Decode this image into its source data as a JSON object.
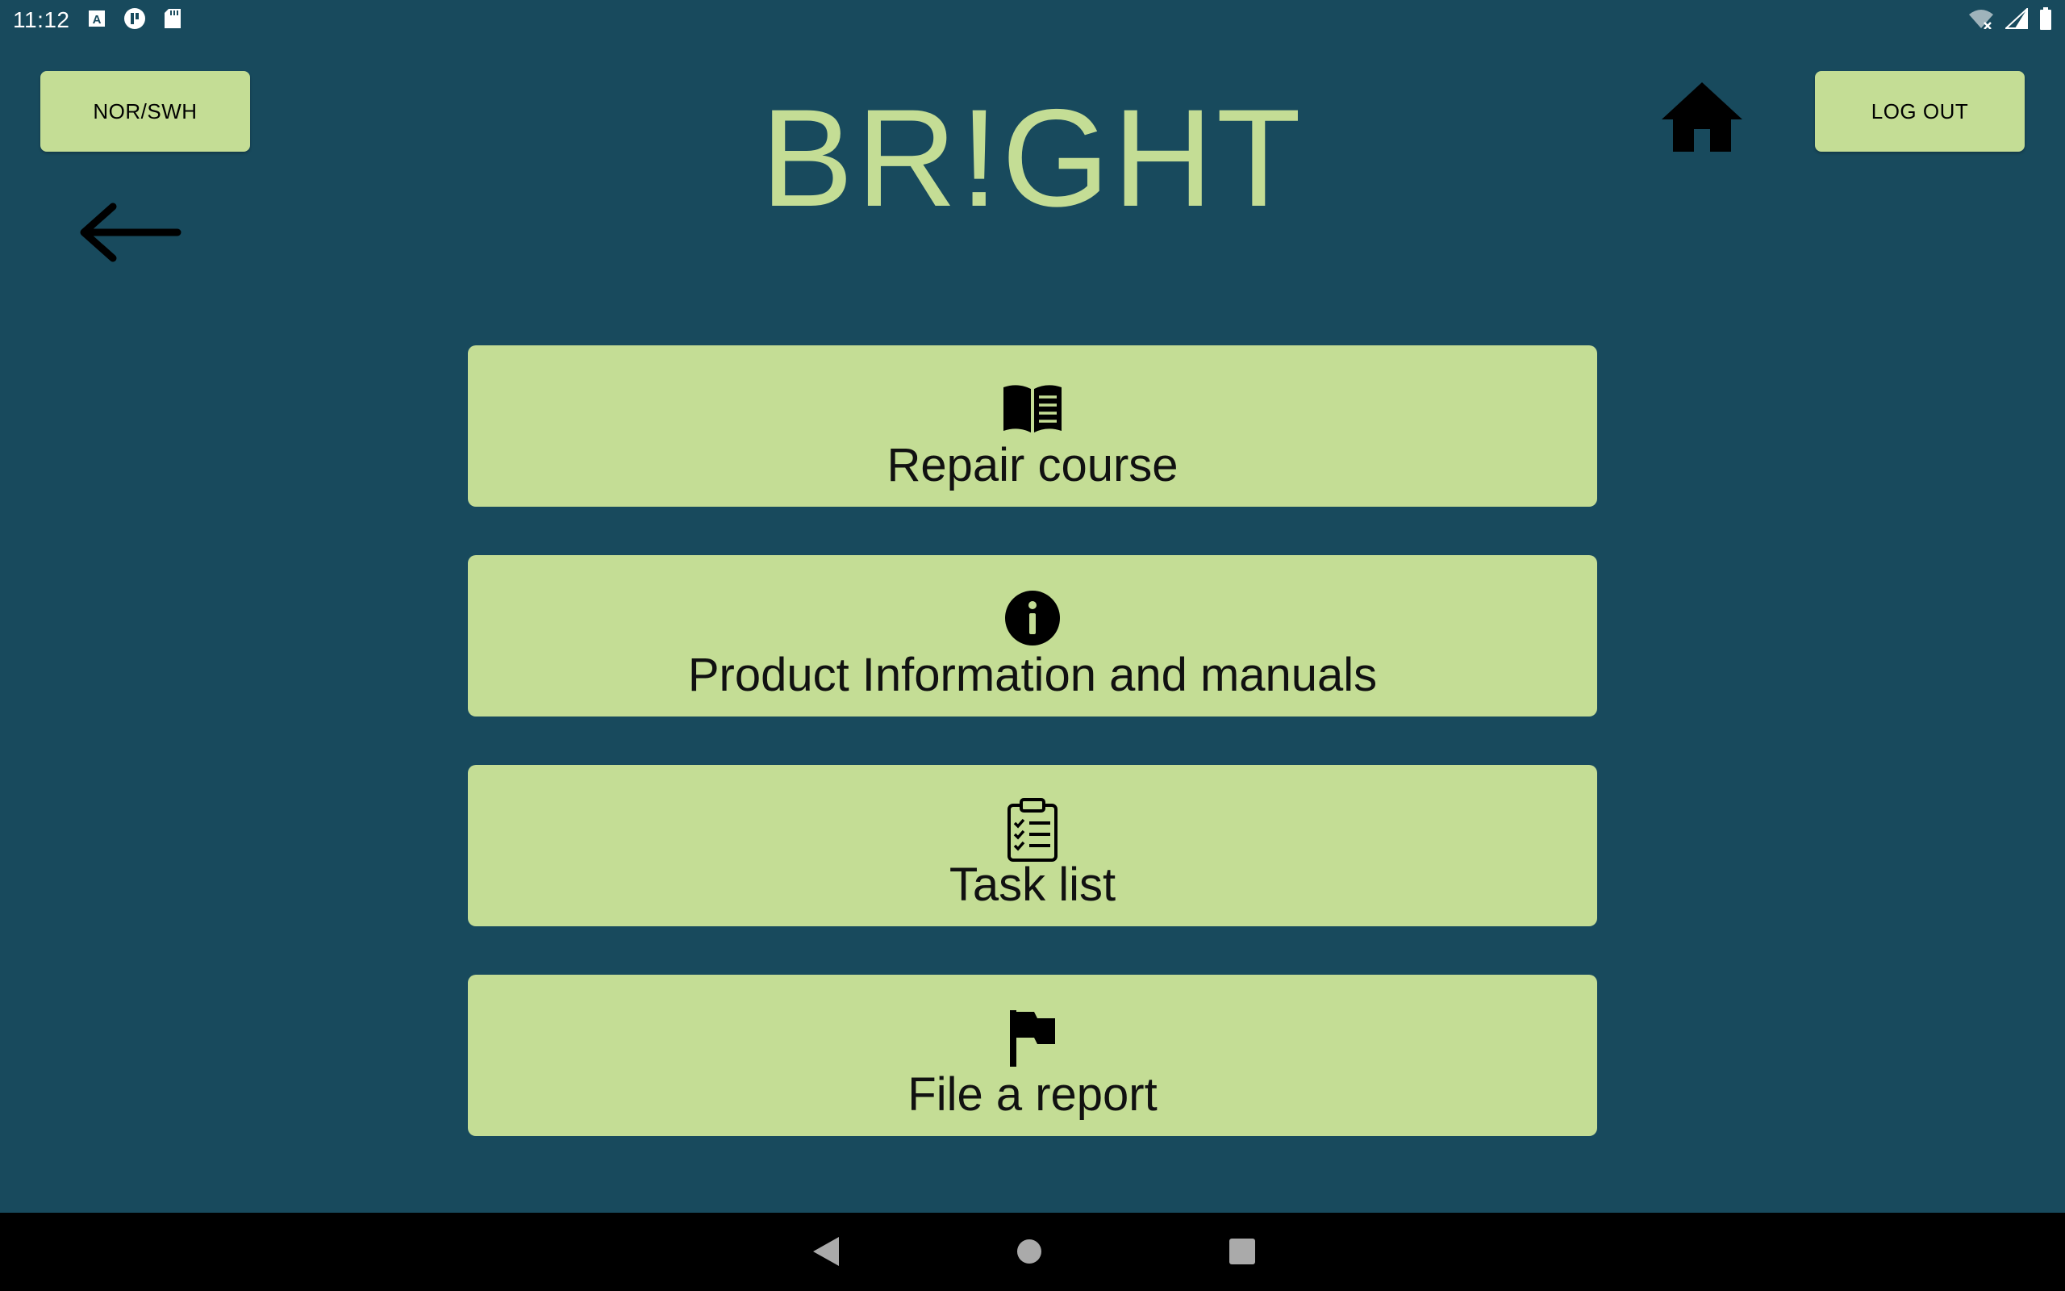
{
  "status_bar": {
    "time": "11:12",
    "left_icons": [
      "a-icon",
      "app-icon",
      "sd-card-icon"
    ],
    "right_icons": [
      "wifi-off-icon",
      "signal-icon",
      "battery-icon"
    ]
  },
  "header": {
    "language_button": "NOR/SWH",
    "title": "BR!GHT",
    "logout_button": "LOG OUT",
    "home_icon": "home-icon",
    "back_icon": "back-arrow-icon"
  },
  "menu": {
    "items": [
      {
        "label": "Repair course",
        "icon": "open-book-icon"
      },
      {
        "label": "Product Information and manuals",
        "icon": "info-icon"
      },
      {
        "label": "Task list",
        "icon": "clipboard-checklist-icon"
      },
      {
        "label": "File a report",
        "icon": "flag-icon"
      }
    ]
  },
  "nav_bar": {
    "buttons": [
      "back-triangle-icon",
      "home-circle-icon",
      "recents-square-icon"
    ]
  },
  "colors": {
    "background": "#184a5d",
    "accent": "#c4dd95",
    "text": "#111111"
  }
}
